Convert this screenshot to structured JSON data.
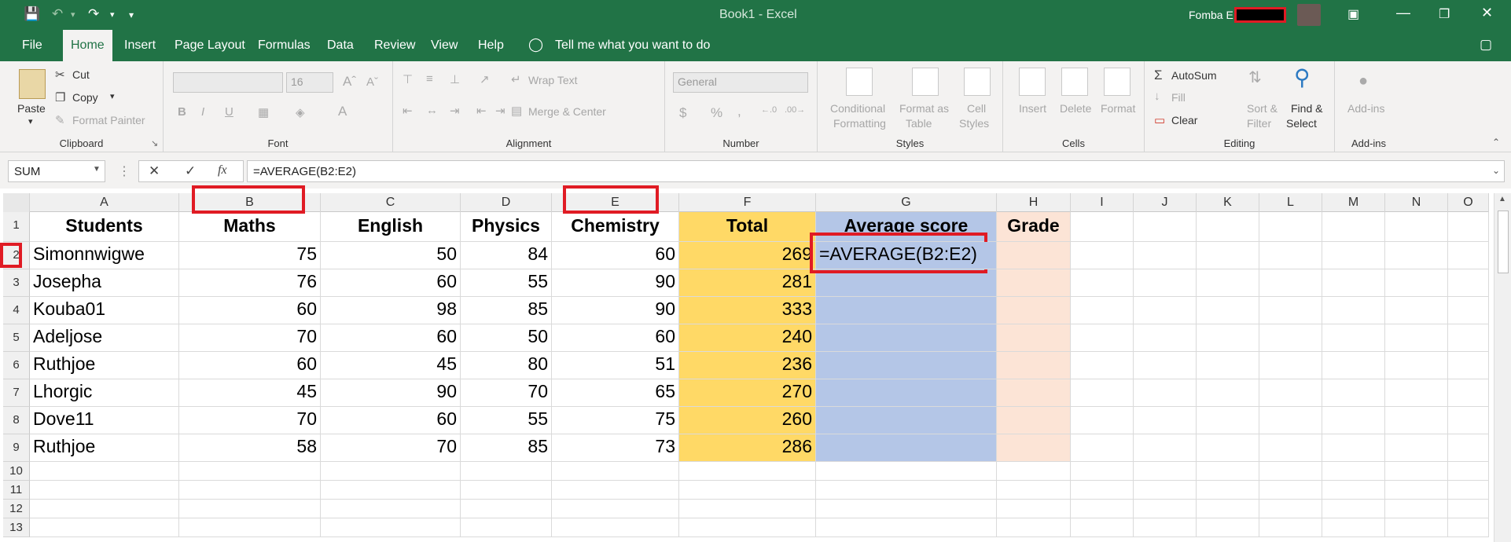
{
  "title_bar": {
    "title": "Book1  -  Excel",
    "user_name": "Fomba E"
  },
  "tabs": [
    "File",
    "Home",
    "Insert",
    "Page Layout",
    "Formulas",
    "Data",
    "Review",
    "View",
    "Help"
  ],
  "tell_me": "Tell me what you want to do",
  "ribbon": {
    "clipboard": {
      "paste": "Paste",
      "cut": "Cut",
      "copy": "Copy",
      "format_painter": "Format Painter",
      "label": "Clipboard"
    },
    "font": {
      "size": "16",
      "bold": "B",
      "italic": "I",
      "underline": "U",
      "label": "Font"
    },
    "alignment": {
      "wrap_text": "Wrap Text",
      "merge_center": "Merge & Center",
      "label": "Alignment"
    },
    "number": {
      "format": "General",
      "currency": "$",
      "percent": "%",
      "comma": ",",
      "label": "Number"
    },
    "styles": {
      "conditional": "Conditional",
      "conditional2": "Formatting",
      "format_as": "Format as",
      "format_as2": "Table",
      "cell": "Cell",
      "cell2": "Styles",
      "label": "Styles"
    },
    "cells": {
      "insert": "Insert",
      "delete": "Delete",
      "format": "Format",
      "label": "Cells"
    },
    "editing": {
      "autosum": "AutoSum",
      "fill": "Fill",
      "clear": "Clear",
      "sort": "Sort &",
      "sort2": "Filter",
      "find": "Find &",
      "find2": "Select",
      "label": "Editing"
    },
    "addins": {
      "addins": "Add-ins",
      "label": "Add-ins"
    }
  },
  "formula_bar": {
    "name_box": "SUM",
    "fx": "fx",
    "formula": "=AVERAGE(B2:E2)"
  },
  "columns": [
    "A",
    "B",
    "C",
    "D",
    "E",
    "F",
    "G",
    "H",
    "I",
    "J",
    "K",
    "L",
    "M",
    "N",
    "O"
  ],
  "rows": [
    "1",
    "2",
    "3",
    "4",
    "5",
    "6",
    "7",
    "8",
    "9",
    "10",
    "11",
    "12",
    "13"
  ],
  "headers": [
    "Students",
    "Maths",
    "English",
    "Physics",
    "Chemistry",
    "Total",
    "Average score",
    "Grade"
  ],
  "data": [
    [
      "Simonnwigwe",
      "75",
      "50",
      "84",
      "60",
      "269"
    ],
    [
      "Josepha",
      "76",
      "60",
      "55",
      "90",
      "281"
    ],
    [
      "Kouba01",
      "60",
      "98",
      "85",
      "90",
      "333"
    ],
    [
      "Adeljose",
      "70",
      "60",
      "50",
      "60",
      "240"
    ],
    [
      "Ruthjoe",
      "60",
      "45",
      "80",
      "51",
      "236"
    ],
    [
      "Lhorgic",
      "45",
      "90",
      "70",
      "65",
      "270"
    ],
    [
      "Dove11",
      "70",
      "60",
      "55",
      "75",
      "260"
    ],
    [
      "Ruthjoe",
      "58",
      "70",
      "85",
      "73",
      "286"
    ]
  ],
  "active_cell_text": "=AVERAGE(B2:E2)",
  "colors": {
    "excel_green": "#217346",
    "total_fill": "#ffd966",
    "average_fill": "#b4c6e7",
    "grade_fill": "#fce4d6",
    "highlight": "#e01b24"
  }
}
